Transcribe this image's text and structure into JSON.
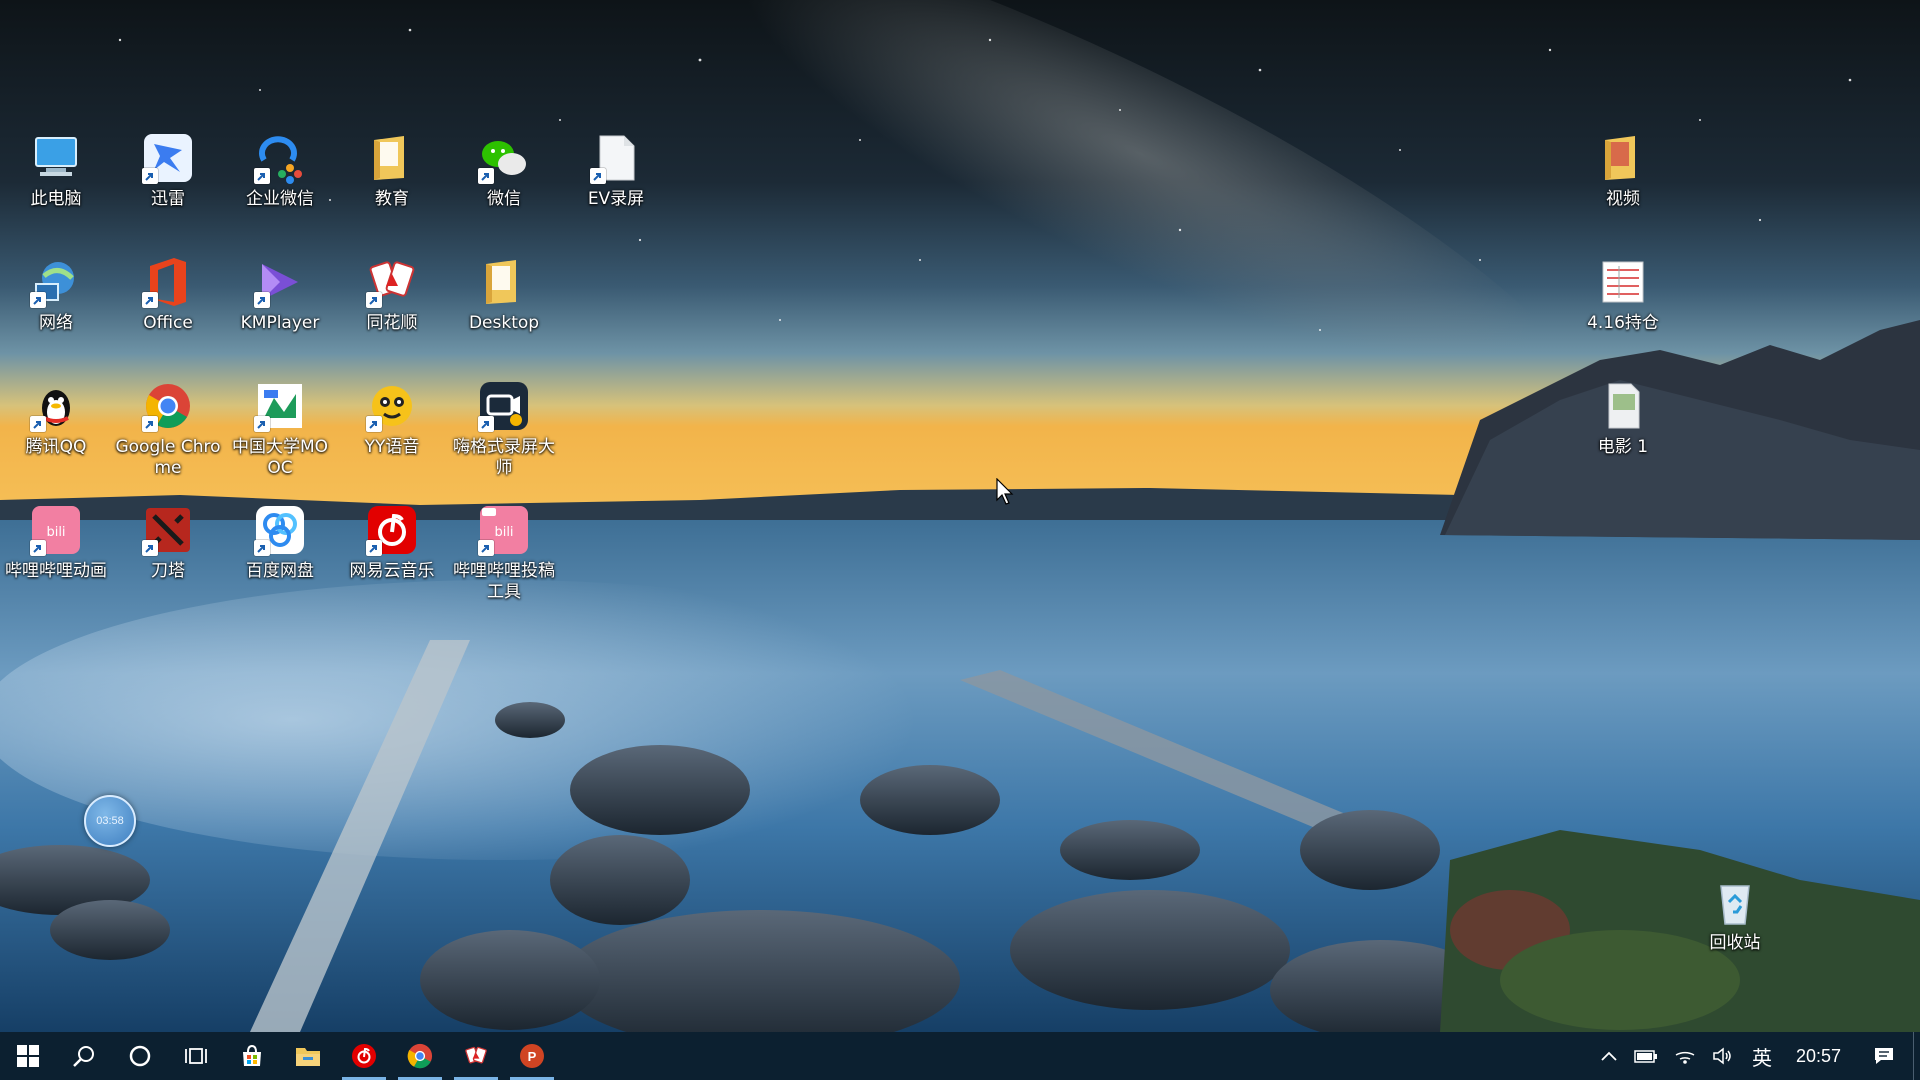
{
  "desktop": {
    "icons": [
      {
        "label": "此电脑"
      },
      {
        "label": "迅雷"
      },
      {
        "label": "企业微信"
      },
      {
        "label": "教育"
      },
      {
        "label": "微信"
      },
      {
        "label": "EV录屏"
      },
      {
        "label": "网络"
      },
      {
        "label": "Office"
      },
      {
        "label": "KMPlayer"
      },
      {
        "label": "同花顺"
      },
      {
        "label": "Desktop"
      },
      {
        "label": "腾讯QQ"
      },
      {
        "label": "Google Chrome"
      },
      {
        "label": "中国大学MOOC"
      },
      {
        "label": "YY语音"
      },
      {
        "label": "嗨格式录屏大师"
      },
      {
        "label": "哔哩哔哩动画"
      },
      {
        "label": "刀塔"
      },
      {
        "label": "百度网盘"
      },
      {
        "label": "网易云音乐"
      },
      {
        "label": "哔哩哔哩投稿工具"
      },
      {
        "label": "视频"
      },
      {
        "label": "4.16持仓"
      },
      {
        "label": "电影 1"
      },
      {
        "label": "回收站"
      }
    ],
    "timer_widget": {
      "text": "03:58"
    }
  },
  "taskbar": {
    "icons": [
      "windows-start-icon",
      "search-icon",
      "cortana-icon",
      "task-view-icon",
      "store-icon",
      "file-explorer-icon",
      "netease-music-icon",
      "chrome-icon",
      "tonghuashun-icon",
      "powerpoint-icon"
    ],
    "tray": {
      "ime": "英",
      "time": "20:57"
    }
  },
  "colors": {
    "taskbar_bg": "#0c2030",
    "active_indicator": "#7ab4e6"
  }
}
